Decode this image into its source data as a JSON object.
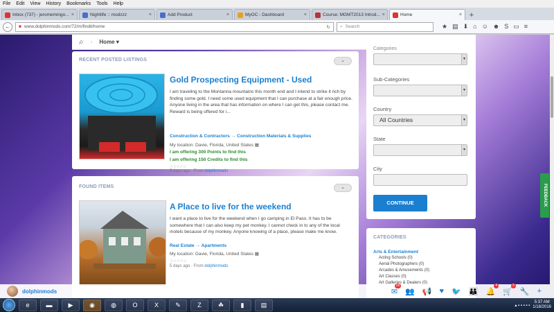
{
  "browser": {
    "menus": [
      "File",
      "Edit",
      "View",
      "History",
      "Bookmarks",
      "Tools",
      "Help"
    ],
    "tabs": [
      {
        "label": "Inbox (737) - jeromemingo...",
        "color": "#d33"
      },
      {
        "label": "Nightlife :: modzzz",
        "color": "#4a6ec9"
      },
      {
        "label": "Add Product",
        "color": "#4a6ec9"
      },
      {
        "label": "MyOC - Dashboard",
        "color": "#e8a020"
      },
      {
        "label": "Course: MGMT2013 Introd...",
        "color": "#b33"
      },
      {
        "label": "Home",
        "color": "#d33"
      }
    ],
    "url": "www.dolphinmods.com/72/m/findit/home",
    "search_placeholder": "Search"
  },
  "site": {
    "breadcrumb": "Home",
    "recent_title": "RECENT POSTED LISTINGS",
    "found_title": "FOUND ITEMS",
    "listings": [
      {
        "title": "Gold Prospecting Equipment - Used",
        "description": "I am traveling to the Montanna mountains this month end and I intend to strike it rich by finding some gold. I need some used equipment that I can purchase at a fair enough price. Anyone living in the area that has information on where I can get this, please contact me. Reward is being offered for i...",
        "category": "Construction & Contractors → Construction Materials & Supplies",
        "location": "My location: Davie, Florida, United States",
        "offer_points": "I am offering 300 Points to find this",
        "offer_credits": "I am offering 150 Credits to find this",
        "meta": "5 days ago · From",
        "author": "dolphinmods"
      },
      {
        "title": "A Place to live for the weekend",
        "description": "I want a place to live for the weekend when I go camping in El Paso. It has to be somewhere that I can also keep my pet monkey. I cannot check in to any of the local motels because of my monkey. Anyone knowing of a place, please make me know.",
        "category": "Real Estate → Apartments",
        "location": "My location: Davie, Florida, United States",
        "meta": "5 days ago · From",
        "author": "dolphinmods"
      }
    ],
    "filters": {
      "categories_label": "Categories",
      "subcategories_label": "Sub-Categories",
      "country_label": "Country",
      "country_value": "All Countries",
      "state_label": "State",
      "city_label": "City",
      "continue": "CONTINUE"
    },
    "categories_panel": {
      "title": "CATEGORIES",
      "heading": "Arts & Entertainment",
      "items": [
        "Acting Schools (0)",
        "Aerial Photographers (0)",
        "Arcades & Amusements (0)",
        "Art Classes (0)",
        "Art Galleries & Dealers (0)"
      ]
    },
    "feedback": "FEEDBACK",
    "user": "dolphinmods",
    "badges": {
      "mail": "18",
      "notifications": "4",
      "cart": "5"
    }
  },
  "taskbar": {
    "time": "5:37 AM",
    "date": "1/18/2016"
  }
}
